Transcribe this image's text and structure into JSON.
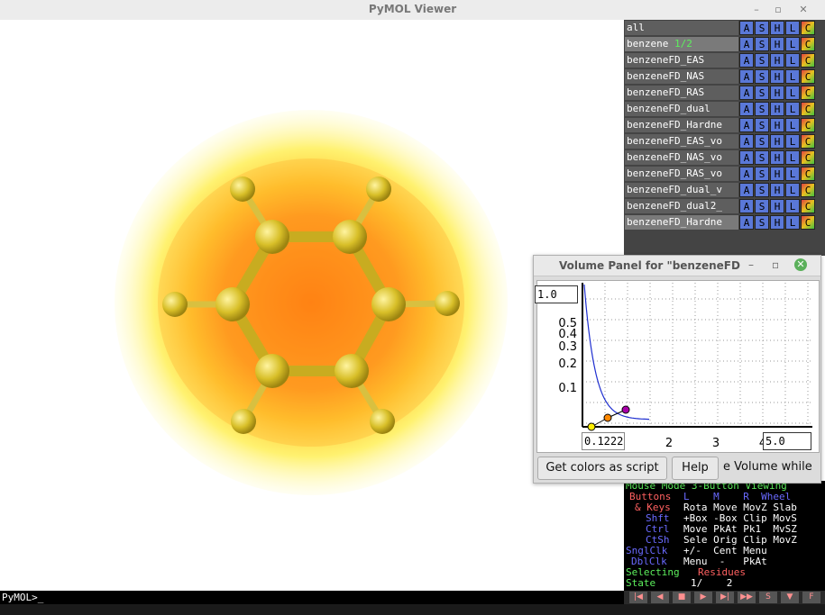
{
  "window": {
    "title": "PyMOL Viewer"
  },
  "command_line": {
    "prompt": "PyMOL>_"
  },
  "objects": [
    {
      "name": "all",
      "state": ""
    },
    {
      "name": "benzene",
      "state": "1/2"
    },
    {
      "name": "benzeneFD_EAS",
      "state": ""
    },
    {
      "name": "benzeneFD_NAS",
      "state": ""
    },
    {
      "name": "benzeneFD_RAS",
      "state": ""
    },
    {
      "name": "benzeneFD_dual",
      "state": ""
    },
    {
      "name": "benzeneFD_Hardne",
      "state": ""
    },
    {
      "name": "benzeneFD_EAS_vo",
      "state": ""
    },
    {
      "name": "benzeneFD_NAS_vo",
      "state": ""
    },
    {
      "name": "benzeneFD_RAS_vo",
      "state": ""
    },
    {
      "name": "benzeneFD_dual_v",
      "state": ""
    },
    {
      "name": "benzeneFD_dual2_",
      "state": ""
    },
    {
      "name": "benzeneFD_Hardne",
      "state": ""
    }
  ],
  "object_buttons": {
    "a": "A",
    "s": "S",
    "h": "H",
    "l": "L",
    "c": "C"
  },
  "volume_panel": {
    "title": "Volume Panel for \"benzeneFD",
    "y_top_value": "1.0",
    "x_min_value": "0.1222",
    "x_max_value": "5.0",
    "y_ticks": [
      "0.5",
      "0.4",
      "0.3",
      "0.2",
      "0.1"
    ],
    "x_ticks": [
      "2",
      "3",
      "4"
    ],
    "get_colors_label": "Get colors as script",
    "help_label": "Help",
    "truncated_label": "e Volume while"
  },
  "mouse_info": {
    "line1": "Mouse Mode 3-Button Viewing",
    "buttons_label": "Buttons",
    "buttons_cols": "L    M    R  Wheel",
    "keys_label": "& Keys",
    "keys_cols": "Rota Move MovZ Slab",
    "shft_label": "Shft",
    "shft_cols": "+Box -Box Clip MovS",
    "ctrl_label": "Ctrl",
    "ctrl_cols": "Move PkAt Pk1  MvSZ",
    "ctsh_label": "CtSh",
    "ctsh_cols": "Sele Orig Clip MovZ",
    "snglclk_label": "SnglClk",
    "snglclk_cols": "+/-  Cent Menu",
    "dblclk_label": "DblClk",
    "dblclk_cols": "Menu  -   PkAt",
    "selecting_label": "Selecting",
    "selecting_value": "Residues",
    "state_label": "State",
    "state_value": "1/    2"
  },
  "colors": {
    "surface_outer": "#fff8a0",
    "surface_mid": "#ffd23a",
    "surface_inner": "#ff8a1a",
    "atom": "#d8c02a"
  }
}
